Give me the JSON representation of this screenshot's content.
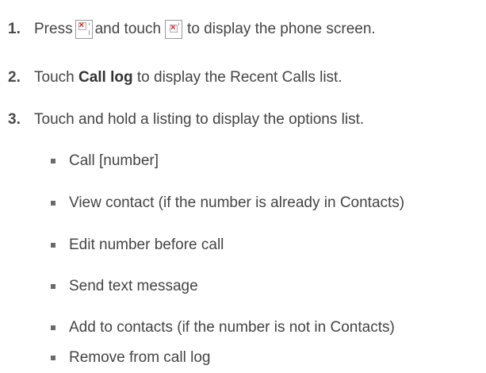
{
  "steps": [
    {
      "num": "1.",
      "parts": [
        "Press",
        "and touch",
        "to display the phone screen."
      ],
      "icons": [
        "phone-key-icon",
        "phone-app-icon"
      ]
    },
    {
      "num": "2.",
      "pre": "Touch ",
      "bold": "Call log",
      "post": " to display the Recent Calls list."
    },
    {
      "num": "3.",
      "text": "Touch and hold a listing to display the options list."
    }
  ],
  "options": [
    "Call [number]",
    "View contact (if the number is already in Contacts)",
    "Edit number before call",
    "Send text message",
    "Add to contacts (if the number is not in Contacts)",
    "Remove from call log"
  ]
}
